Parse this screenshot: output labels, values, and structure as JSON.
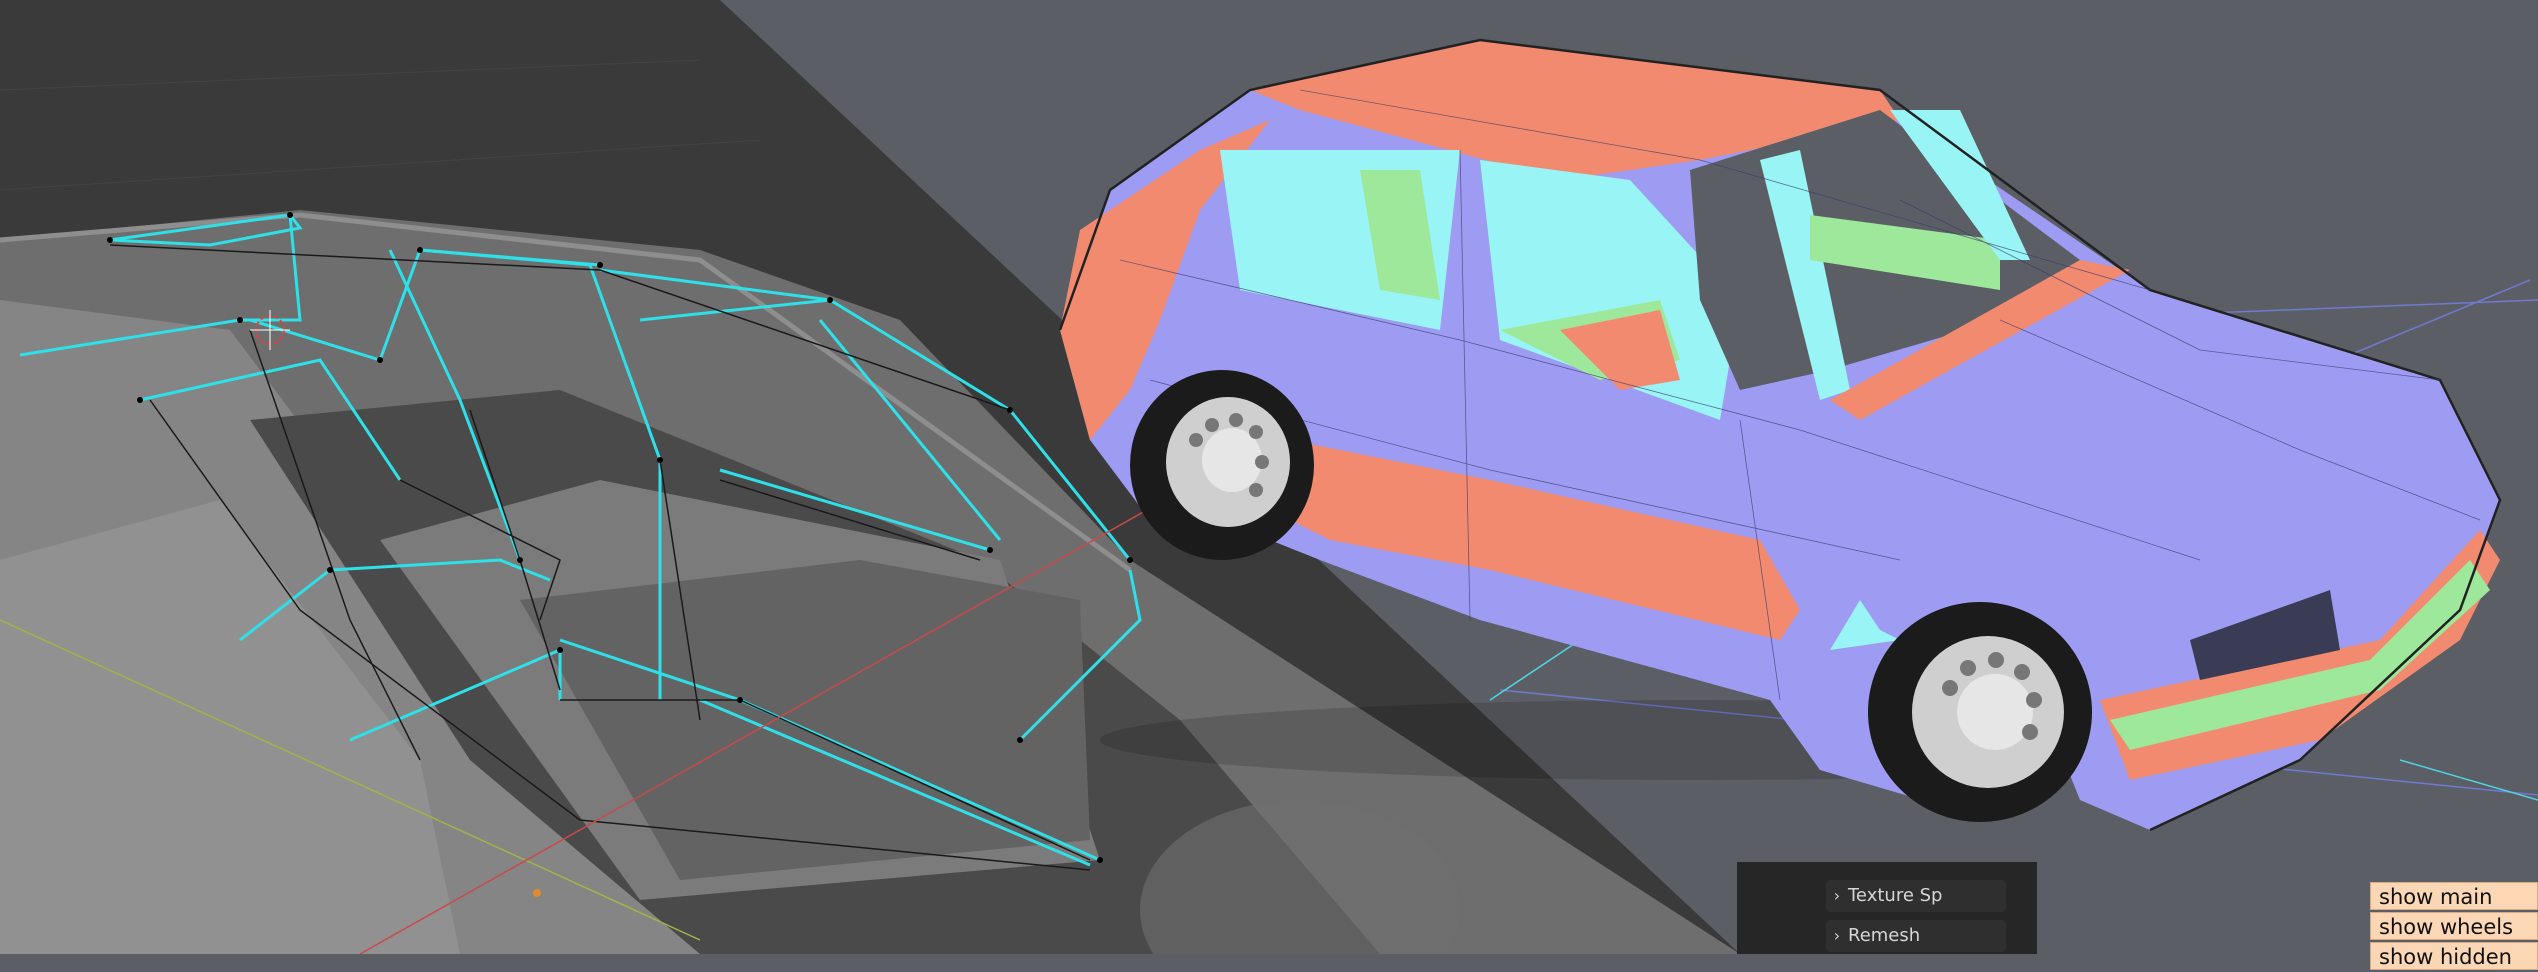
{
  "panel": {
    "items": [
      {
        "label": "Texture Sp"
      },
      {
        "label": "Remesh"
      }
    ]
  },
  "overlay_buttons": [
    {
      "label": "show main"
    },
    {
      "label": "show wheels"
    },
    {
      "label": "show hidden"
    }
  ],
  "colors": {
    "background": "#5c5e66",
    "body_blue": "#9d9cf2",
    "body_red": "#f28a70",
    "glass_green": "#9ee89b",
    "glass_cyan": "#99f5f5",
    "selection_cyan": "#2ee0e8",
    "button_bg": "#fbd7b6"
  },
  "icons": [
    "chevron-right-icon",
    "3d-cursor-icon",
    "world-origin-icon"
  ]
}
